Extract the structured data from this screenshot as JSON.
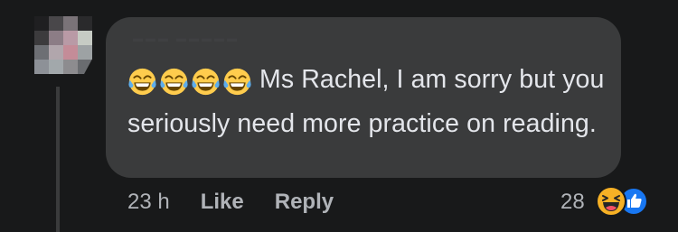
{
  "comment": {
    "author_name": "▬▬▬ ▬▬▬▬▬",
    "emojis": [
      "laughing-tears-icon",
      "laughing-tears-icon",
      "laughing-tears-icon",
      "laughing-tears-icon"
    ],
    "text": "Ms Rachel, I am sorry but you seriously need more practice on reading.",
    "timestamp": "23 h",
    "like_label": "Like",
    "reply_label": "Reply",
    "reaction_count": "28",
    "reaction_types": [
      "haha-reaction-icon",
      "like-reaction-icon"
    ]
  },
  "colors": {
    "background": "#18191a",
    "bubble": "#3a3b3c",
    "text_primary": "#e4e6eb",
    "text_secondary": "#b0b3b8",
    "like_blue": "#1877f2",
    "haha_yellow": "#f7b125"
  }
}
